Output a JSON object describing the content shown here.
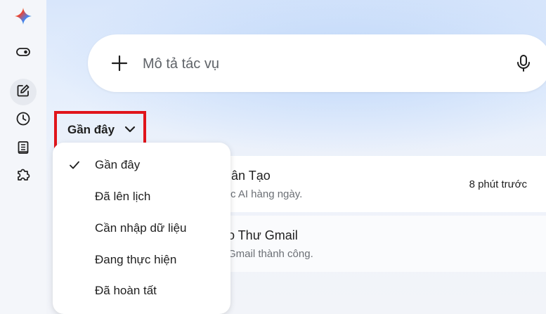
{
  "search": {
    "placeholder": "Mô tả tác vụ"
  },
  "filter": {
    "label": "Gần đây"
  },
  "menu": {
    "items": [
      {
        "label": "Gần đây",
        "selected": true
      },
      {
        "label": "Đã lên lịch",
        "selected": false
      },
      {
        "label": "Cần nhập dữ liệu",
        "selected": false
      },
      {
        "label": "Đang thực hiện",
        "selected": false
      },
      {
        "label": "Đã hoàn tất",
        "selected": false
      }
    ]
  },
  "tasks": [
    {
      "title": "ân Tạo",
      "desc": "c AI hàng ngày.",
      "time": "8 phút trước"
    },
    {
      "title": "o Thư Gmail",
      "desc": "Gmail thành công.",
      "time": ""
    }
  ],
  "icons": {
    "logo": "gemini-sparkle-icon",
    "rail": [
      "toggle-icon",
      "edit-icon",
      "clock-icon",
      "notebook-icon",
      "puzzle-icon"
    ]
  },
  "colors": {
    "highlight_border": "#e0141b"
  }
}
